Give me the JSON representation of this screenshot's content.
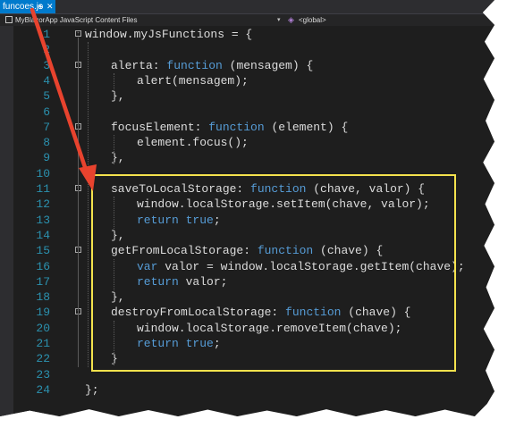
{
  "tab": {
    "label": "funcoes.js",
    "pin_glyph": "⊕",
    "close_glyph": "✕"
  },
  "nav": {
    "project": "MyBlazorApp JavaScript Content Files",
    "scope": "<global>"
  },
  "code_lines": [
    {
      "n": "1",
      "fold": "-",
      "indent": 0,
      "tokens": [
        {
          "t": "window.myJsFunctions = {",
          "c": "prop"
        }
      ]
    },
    {
      "n": "2",
      "indent": 1,
      "tokens": []
    },
    {
      "n": "3",
      "fold": "-",
      "indent": 1,
      "tokens": [
        {
          "t": "alerta: ",
          "c": "prop"
        },
        {
          "t": "function",
          "c": "kw"
        },
        {
          "t": " (mensagem) {",
          "c": "prop"
        }
      ]
    },
    {
      "n": "4",
      "indent": 2,
      "tokens": [
        {
          "t": "alert(mensagem);",
          "c": "prop"
        }
      ]
    },
    {
      "n": "5",
      "indent": 1,
      "tokens": [
        {
          "t": "},",
          "c": "prop"
        }
      ]
    },
    {
      "n": "6",
      "indent": 1,
      "tokens": []
    },
    {
      "n": "7",
      "fold": "-",
      "indent": 1,
      "tokens": [
        {
          "t": "focusElement: ",
          "c": "prop"
        },
        {
          "t": "function",
          "c": "kw"
        },
        {
          "t": " (element) {",
          "c": "prop"
        }
      ]
    },
    {
      "n": "8",
      "indent": 2,
      "tokens": [
        {
          "t": "element.focus();",
          "c": "prop"
        }
      ]
    },
    {
      "n": "9",
      "indent": 1,
      "tokens": [
        {
          "t": "},",
          "c": "prop"
        }
      ]
    },
    {
      "n": "10",
      "indent": 1,
      "tokens": []
    },
    {
      "n": "11",
      "fold": "-",
      "indent": 1,
      "tokens": [
        {
          "t": "saveToLocalStorage: ",
          "c": "prop"
        },
        {
          "t": "function",
          "c": "kw"
        },
        {
          "t": " (chave, valor) {",
          "c": "prop"
        }
      ]
    },
    {
      "n": "12",
      "indent": 2,
      "tokens": [
        {
          "t": "window.localStorage.setItem(chave, valor);",
          "c": "prop"
        }
      ]
    },
    {
      "n": "13",
      "indent": 2,
      "tokens": [
        {
          "t": "return",
          "c": "kw"
        },
        {
          "t": " ",
          "c": "prop"
        },
        {
          "t": "true",
          "c": "kw"
        },
        {
          "t": ";",
          "c": "prop"
        }
      ]
    },
    {
      "n": "14",
      "indent": 1,
      "tokens": [
        {
          "t": "},",
          "c": "prop"
        }
      ]
    },
    {
      "n": "15",
      "fold": "-",
      "indent": 1,
      "tokens": [
        {
          "t": "getFromLocalStorage: ",
          "c": "prop"
        },
        {
          "t": "function",
          "c": "kw"
        },
        {
          "t": " (chave) {",
          "c": "prop"
        }
      ]
    },
    {
      "n": "16",
      "indent": 2,
      "tokens": [
        {
          "t": "var",
          "c": "kw"
        },
        {
          "t": " valor = window.localStorage.getItem(chave);",
          "c": "prop"
        }
      ]
    },
    {
      "n": "17",
      "indent": 2,
      "tokens": [
        {
          "t": "return",
          "c": "kw"
        },
        {
          "t": " valor;",
          "c": "prop"
        }
      ]
    },
    {
      "n": "18",
      "indent": 1,
      "tokens": [
        {
          "t": "},",
          "c": "prop"
        }
      ]
    },
    {
      "n": "19",
      "fold": "-",
      "indent": 1,
      "tokens": [
        {
          "t": "destroyFromLocalStorage: ",
          "c": "prop"
        },
        {
          "t": "function",
          "c": "kw"
        },
        {
          "t": " (chave) {",
          "c": "prop"
        }
      ]
    },
    {
      "n": "20",
      "indent": 2,
      "tokens": [
        {
          "t": "window.localStorage.removeItem(chave);",
          "c": "prop"
        }
      ]
    },
    {
      "n": "21",
      "indent": 2,
      "tokens": [
        {
          "t": "return",
          "c": "kw"
        },
        {
          "t": " ",
          "c": "prop"
        },
        {
          "t": "true",
          "c": "kw"
        },
        {
          "t": ";",
          "c": "prop"
        }
      ]
    },
    {
      "n": "22",
      "indent": 1,
      "tokens": [
        {
          "t": "}",
          "c": "prop"
        }
      ]
    },
    {
      "n": "23",
      "indent": 0,
      "tokens": []
    },
    {
      "n": "24",
      "indent": 0,
      "tokens": [
        {
          "t": "};",
          "c": "prop"
        }
      ]
    }
  ],
  "colors": {
    "editor_bg": "#1e1e1e",
    "line_number": "#2b91af",
    "keyword": "#569cd6",
    "text": "#dcdcdc",
    "tab_active": "#007acc",
    "highlight_box": "#f4e24d",
    "arrow": "#e8432e"
  },
  "annotations": {
    "highlight_box_lines": "11-22",
    "arrow": "from tab to line 11"
  }
}
